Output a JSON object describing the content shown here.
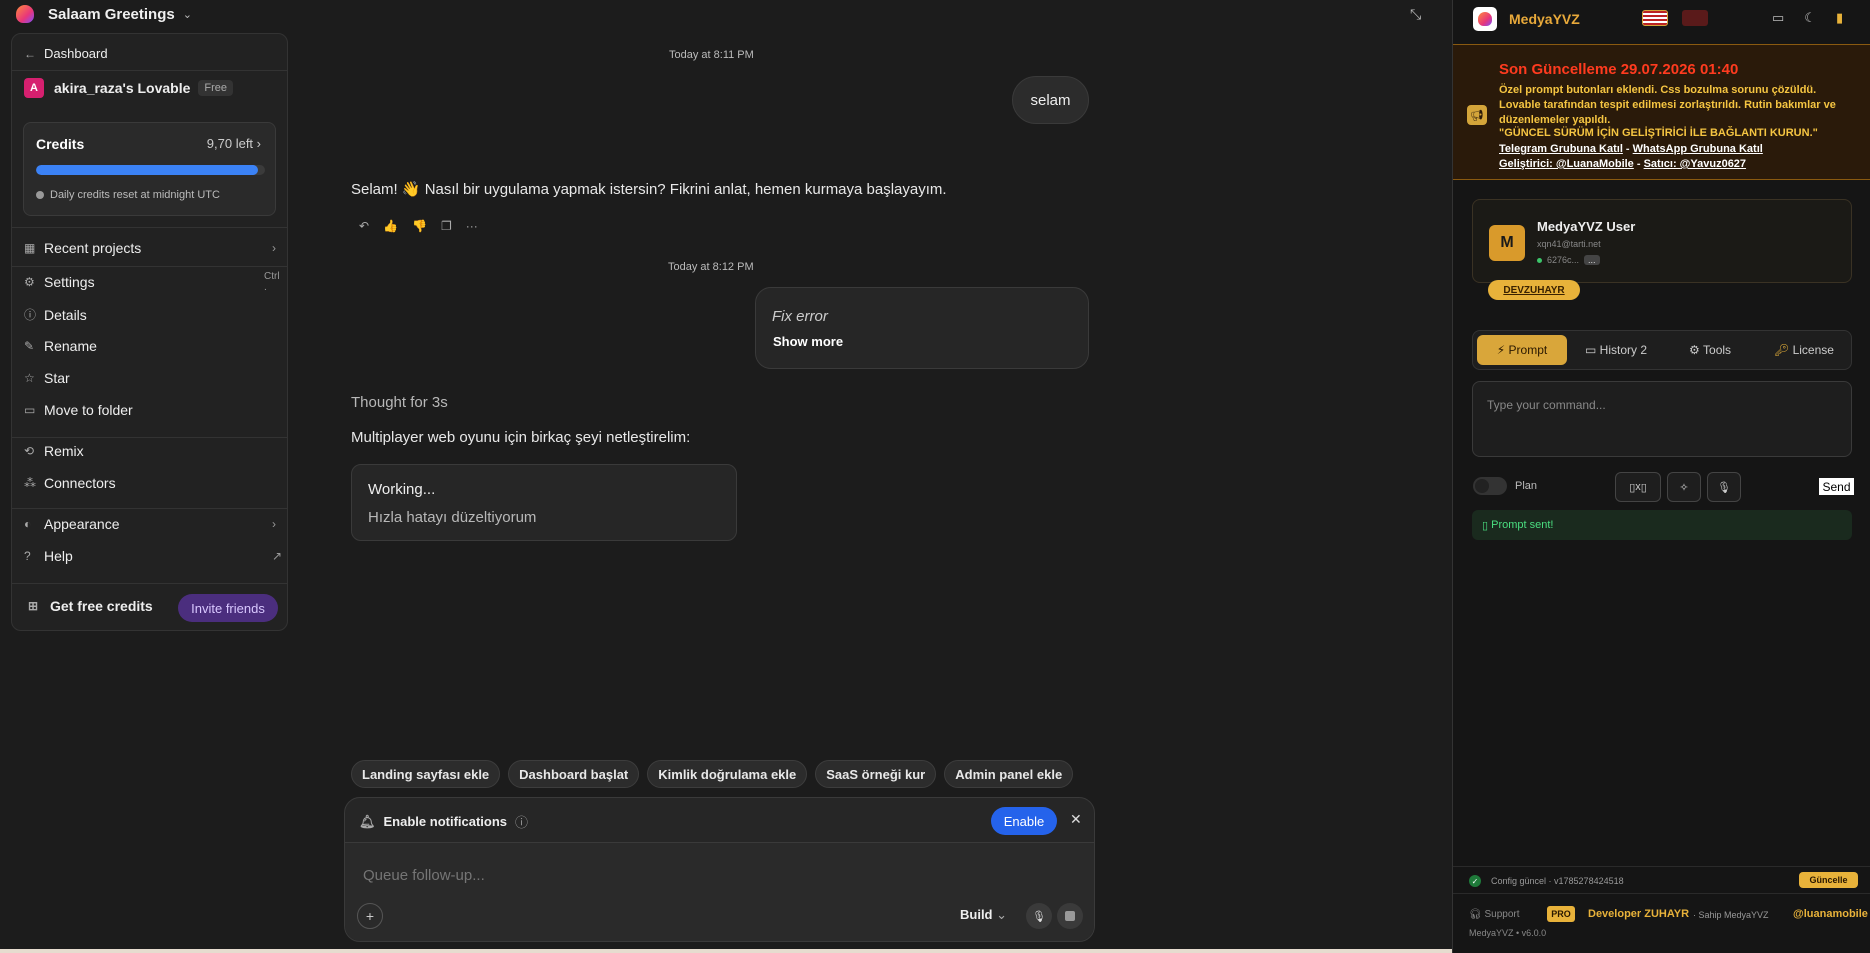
{
  "topbar": {
    "project": "Salaam Greetings"
  },
  "menu": {
    "back_label": "Dashboard",
    "workspace": {
      "initial": "A",
      "name": "akira_raza's Lovable",
      "plan": "Free"
    },
    "credits": {
      "title": "Credits",
      "left": "9,70 left",
      "fill": 0.97,
      "note": "Daily credits reset at midnight UTC"
    },
    "recent": "Recent projects",
    "settings": "Settings",
    "settings_shortcut": "Ctrl .",
    "details": "Details",
    "rename": "Rename",
    "star": "Star",
    "move": "Move to folder",
    "remix": "Remix",
    "connectors": "Connectors",
    "appearance": "Appearance",
    "help": "Help",
    "free_credits": "Get free credits",
    "invite": "Invite friends"
  },
  "chat": {
    "ts1": "Today at 8:11 PM",
    "user_msg": "selam",
    "assistant_msg": "Selam! 👋 Nasıl bir uygulama yapmak istersin? Fikrini anlat, hemen kurmaya başlayayım.",
    "ts2": "Today at 8:12 PM",
    "fix_title": "Fix error",
    "fix_more": "Show more",
    "thought": "Thought for 3s",
    "multiplayer": "Multiplayer web oyunu için birkaç şeyi netleştirelim:",
    "working_title": "Working...",
    "working_sub": "Hızla hatayı düzeltiyorum"
  },
  "chips": [
    "Landing sayfası ekle",
    "Dashboard başlat",
    "Kimlik doğrulama ekle",
    "SaaS örneği kur",
    "Admin panel ekle"
  ],
  "composer": {
    "notif_label": "Enable notifications",
    "enable": "Enable",
    "placeholder": "Queue follow-up...",
    "build": "Build"
  },
  "panel": {
    "title": "MedyaYVZ",
    "update_title": "Son Güncelleme 29.07.2026 01:40",
    "update_text": "Özel prompt butonları eklendi. Css bozulma sorunu çözüldü. Lovable tarafından tespit edilmesi zorlaştırıldı. Rutin bakımlar ve düzenlemeler yapıldı.",
    "update_quote": "\"GÜNCEL SÜRÜM İÇİN GELİŞTİRİCİ İLE BAĞLANTI KURUN.\"",
    "link_telegram": "Telegram Grubuna Katıl",
    "link_whatsapp": "WhatsApp Grubuna Katıl",
    "link_dev": "Geliştirici: @LuanaMobile",
    "link_seller": "Satıcı: @Yavuz0627",
    "user_initial": "M",
    "user_name": "MedyaYVZ User",
    "user_email": "xqn41@tarti.net",
    "user_id": "6276c...",
    "user_more": "...",
    "user_badge": "DEVZUHAYR",
    "tab_prompt": "Prompt",
    "tab_history": "History 2",
    "tab_tools": "Tools",
    "tab_license": "License",
    "cmd_placeholder": "Type your command...",
    "plan": "Plan",
    "tool_x": "x",
    "send": "Send",
    "sent_msg": "Prompt sent!",
    "config": "Config güncel · v1785278424518",
    "config_btn": "Güncelle",
    "support": "Support",
    "pro": "PRO",
    "developer": "Developer ZUHAYR",
    "owner": "· Sahip MedyaYVZ",
    "handle": "@luanamobile",
    "version": "MedyaYVZ • v6.0.0"
  }
}
